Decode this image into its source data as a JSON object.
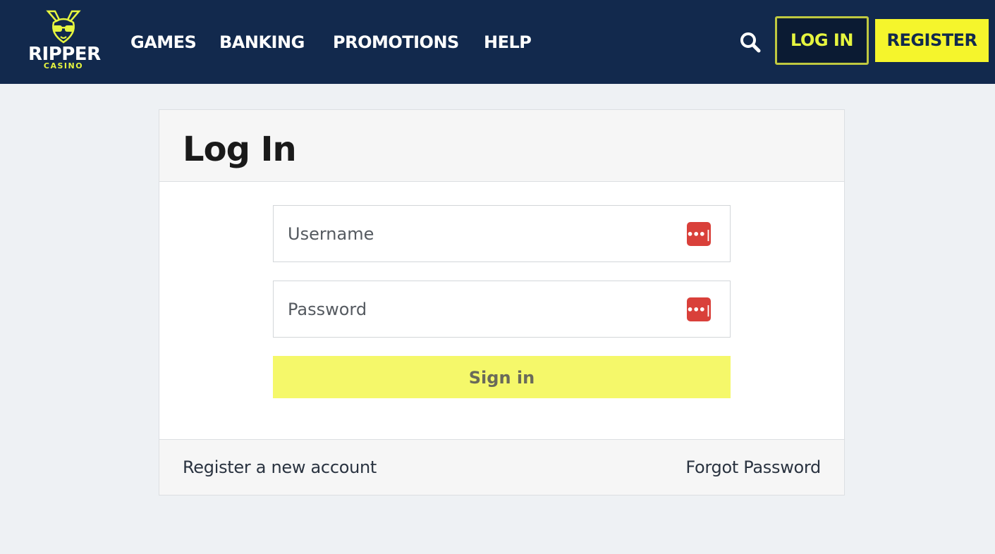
{
  "header": {
    "logo": {
      "word": "RIPPER",
      "sub": "CASINO",
      "icon": "kangaroo-sunglasses-icon"
    },
    "nav": [
      {
        "label": "GAMES"
      },
      {
        "label": "BANKING"
      },
      {
        "label": "PROMOTIONS"
      },
      {
        "label": "HELP"
      }
    ],
    "search_icon": "search-icon",
    "login_label": "LOG IN",
    "register_label": "REGISTER"
  },
  "login_card": {
    "title": "Log In",
    "username": {
      "placeholder": "Username",
      "value": ""
    },
    "password": {
      "placeholder": "Password",
      "value": ""
    },
    "password_manager_icon_text": "•••|",
    "signin_label": "Sign in",
    "register_link": "Register a new account",
    "forgot_link": "Forgot Password"
  },
  "colors": {
    "header_bg": "#12294d",
    "accent_yellow": "#f5f52c",
    "signin_yellow": "#f5f86a",
    "page_bg": "#eef1f4",
    "pw_icon_red": "#d9403a"
  }
}
